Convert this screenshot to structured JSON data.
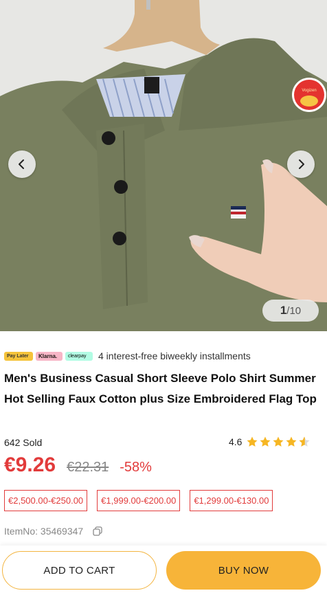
{
  "gallery": {
    "current": "1",
    "separator": "/",
    "total": "10",
    "badge_text": "Vogizen"
  },
  "payments": {
    "logos": [
      "Pay Later",
      "Klarna.",
      "clearpay"
    ],
    "text": "4 interest-free biweekly installments"
  },
  "product": {
    "title": "Men's Business Casual Short Sleeve Polo Shirt Summer Hot Selling Faux Cotton plus Size Embroidered Flag Top",
    "sold": "642 Sold",
    "rating": "4.6",
    "rating_value": 4.6,
    "price": "€9.26",
    "old_price": "€22.31",
    "discount": "-58%",
    "tiers": [
      "€2,500.00-€250.00",
      "€1,999.00-€200.00",
      "€1,299.00-€130.00"
    ],
    "item_no": "ItemNo: 35469347"
  },
  "actions": {
    "add_to_cart": "ADD TO CART",
    "buy_now": "BUY NOW"
  },
  "colors": {
    "accent_red": "#e23b3b",
    "button_yellow": "#f7b439",
    "star_yellow": "#f6b623"
  },
  "icons": [
    "chevron-left-icon",
    "chevron-right-icon",
    "copy-icon",
    "star-icon"
  ]
}
